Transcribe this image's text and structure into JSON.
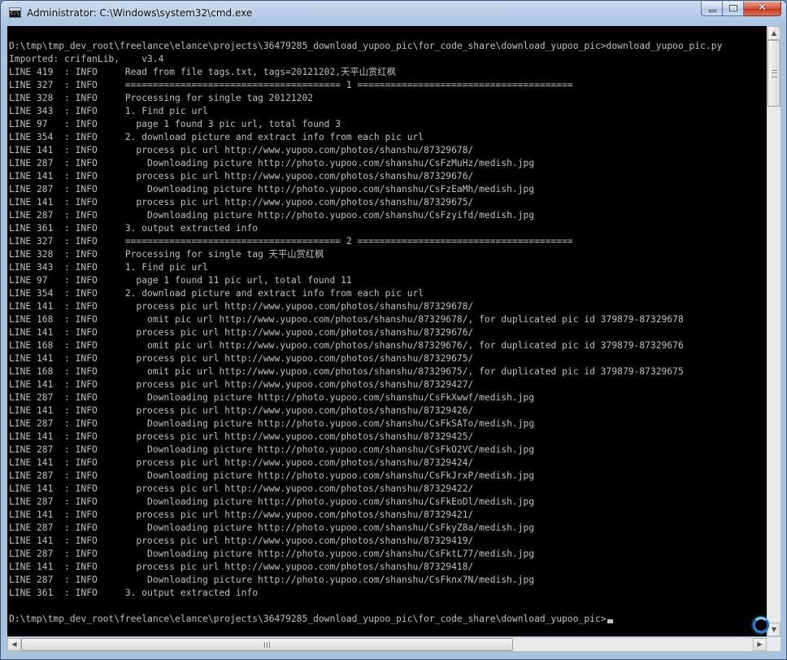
{
  "window": {
    "title": "Administrator: C:\\Windows\\system32\\cmd.exe"
  },
  "icons": {
    "app": "cmd-app-icon",
    "minimize": "minimize-icon",
    "maximize": "maximize-icon",
    "close": "close-icon",
    "busy": "busy-spinner-icon"
  },
  "caption": {
    "close_glyph": "✕"
  },
  "console": {
    "lines": [
      "D:\\tmp\\tmp_dev_root\\freelance\\elance\\projects\\36479285_download_yupoo_pic\\for_code_share\\download_yupoo_pic>download_yupoo_pic.py",
      "Imported: crifanLib,    v3.4",
      "LINE 419  : INFO     Read from file tags.txt, tags=20121202,天平山赏红枫",
      "LINE 327  : INFO     ======================================= 1 =======================================",
      "LINE 328  : INFO     Processing for single tag 20121202",
      "LINE 343  : INFO     1. Find pic url",
      "LINE 97   : INFO       page 1 found 3 pic url, total found 3",
      "LINE 354  : INFO     2. download picture and extract info from each pic url",
      "LINE 141  : INFO       process pic url http://www.yupoo.com/photos/shanshu/87329678/",
      "LINE 287  : INFO         Downloading picture http://photo.yupoo.com/shanshu/CsFzMuHz/medish.jpg",
      "LINE 141  : INFO       process pic url http://www.yupoo.com/photos/shanshu/87329676/",
      "LINE 287  : INFO         Downloading picture http://photo.yupoo.com/shanshu/CsFzEaMh/medish.jpg",
      "LINE 141  : INFO       process pic url http://www.yupoo.com/photos/shanshu/87329675/",
      "LINE 287  : INFO         Downloading picture http://photo.yupoo.com/shanshu/CsFzyifd/medish.jpg",
      "LINE 361  : INFO     3. output extracted info",
      "LINE 327  : INFO     ======================================= 2 =======================================",
      "LINE 328  : INFO     Processing for single tag 天平山赏红枫",
      "LINE 343  : INFO     1. Find pic url",
      "LINE 97   : INFO       page 1 found 11 pic url, total found 11",
      "LINE 354  : INFO     2. download picture and extract info from each pic url",
      "LINE 141  : INFO       process pic url http://www.yupoo.com/photos/shanshu/87329678/",
      "LINE 168  : INFO         omit pic url http://www.yupoo.com/photos/shanshu/87329678/, for duplicated pic id 379879-87329678",
      "LINE 141  : INFO       process pic url http://www.yupoo.com/photos/shanshu/87329676/",
      "LINE 168  : INFO         omit pic url http://www.yupoo.com/photos/shanshu/87329676/, for duplicated pic id 379879-87329676",
      "LINE 141  : INFO       process pic url http://www.yupoo.com/photos/shanshu/87329675/",
      "LINE 168  : INFO         omit pic url http://www.yupoo.com/photos/shanshu/87329675/, for duplicated pic id 379879-87329675",
      "LINE 141  : INFO       process pic url http://www.yupoo.com/photos/shanshu/87329427/",
      "LINE 287  : INFO         Downloading picture http://photo.yupoo.com/shanshu/CsFkXwwf/medish.jpg",
      "LINE 141  : INFO       process pic url http://www.yupoo.com/photos/shanshu/87329426/",
      "LINE 287  : INFO         Downloading picture http://photo.yupoo.com/shanshu/CsFkSATo/medish.jpg",
      "LINE 141  : INFO       process pic url http://www.yupoo.com/photos/shanshu/87329425/",
      "LINE 287  : INFO         Downloading picture http://photo.yupoo.com/shanshu/CsFkO2VC/medish.jpg",
      "LINE 141  : INFO       process pic url http://www.yupoo.com/photos/shanshu/87329424/",
      "LINE 287  : INFO         Downloading picture http://photo.yupoo.com/shanshu/CsFkJrxP/medish.jpg",
      "LINE 141  : INFO       process pic url http://www.yupoo.com/photos/shanshu/87329422/",
      "LINE 287  : INFO         Downloading picture http://photo.yupoo.com/shanshu/CsFkEoDl/medish.jpg",
      "LINE 141  : INFO       process pic url http://www.yupoo.com/photos/shanshu/87329421/",
      "LINE 287  : INFO         Downloading picture http://photo.yupoo.com/shanshu/CsFkyZ8a/medish.jpg",
      "LINE 141  : INFO       process pic url http://www.yupoo.com/photos/shanshu/87329419/",
      "LINE 287  : INFO         Downloading picture http://photo.yupoo.com/shanshu/CsFktL77/medish.jpg",
      "LINE 141  : INFO       process pic url http://www.yupoo.com/photos/shanshu/87329418/",
      "LINE 287  : INFO         Downloading picture http://photo.yupoo.com/shanshu/CsFknx7N/medish.jpg",
      "LINE 361  : INFO     3. output extracted info"
    ],
    "prompt": "D:\\tmp\\tmp_dev_root\\freelance\\elance\\projects\\36479285_download_yupoo_pic\\for_code_share\\download_yupoo_pic>"
  },
  "scrollbars": {
    "up_glyph": "▲",
    "down_glyph": "▼",
    "left_glyph": "◀",
    "right_glyph": "▶"
  }
}
